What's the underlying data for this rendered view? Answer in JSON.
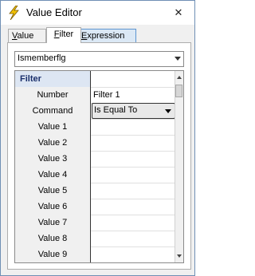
{
  "window": {
    "title": "Value Editor",
    "close_glyph": "✕"
  },
  "tabs": [
    {
      "label": "Value",
      "underline": "V",
      "rest": "alue"
    },
    {
      "label": "Filter",
      "underline": "F",
      "rest": "ilter"
    },
    {
      "label": "Expression",
      "underline": "E",
      "rest": "xpression"
    }
  ],
  "field_select": {
    "value": "Ismemberflg"
  },
  "grid": {
    "header": "Filter",
    "rows": [
      {
        "label": "Number",
        "value": "Filter 1"
      },
      {
        "label": "Command",
        "value": "Is Equal To"
      },
      {
        "label": "Value 1",
        "value": ""
      },
      {
        "label": "Value 2",
        "value": ""
      },
      {
        "label": "Value 3",
        "value": ""
      },
      {
        "label": "Value 4",
        "value": ""
      },
      {
        "label": "Value 5",
        "value": ""
      },
      {
        "label": "Value 6",
        "value": ""
      },
      {
        "label": "Value 7",
        "value": ""
      },
      {
        "label": "Value 8",
        "value": ""
      },
      {
        "label": "Value 9",
        "value": ""
      }
    ]
  },
  "icons": {
    "app": "lightning-bolt-icon"
  }
}
